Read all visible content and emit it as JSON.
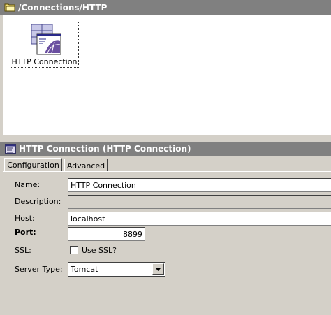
{
  "top_header": {
    "path": "/Connections/HTTP"
  },
  "canvas": {
    "tiles": [
      {
        "label": "HTTP Connection"
      }
    ]
  },
  "props_header": {
    "title": "HTTP Connection (HTTP Connection)"
  },
  "tabs": [
    {
      "label": "Configuration",
      "active": true
    },
    {
      "label": "Advanced",
      "active": false
    }
  ],
  "form": {
    "name": {
      "label": "Name:",
      "value": "HTTP Connection"
    },
    "description": {
      "label": "Description:",
      "value": ""
    },
    "host": {
      "label": "Host:",
      "value": "localhost"
    },
    "port": {
      "label": "Port:",
      "value": "8899"
    },
    "ssl": {
      "label": "SSL:",
      "checkbox_label": "Use SSL?",
      "checked": false
    },
    "server_type": {
      "label": "Server Type:",
      "value": "Tomcat"
    }
  },
  "colors": {
    "header_bg": "#808080",
    "panel_bg": "#d4d0c8",
    "icon_purple": "#6a4fa0"
  }
}
